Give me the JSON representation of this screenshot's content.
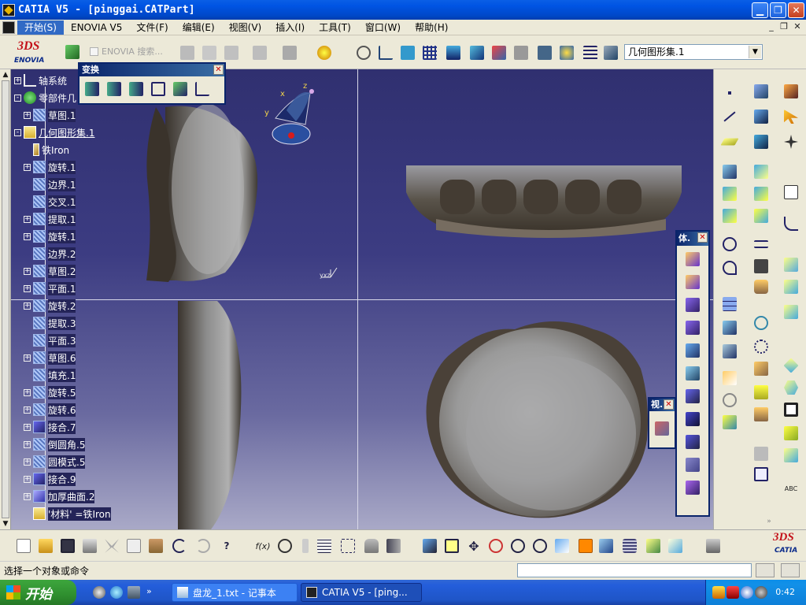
{
  "window": {
    "title": "CATIA V5 - [pinggai.CATPart]"
  },
  "menu": {
    "items": [
      "开始(S)",
      "ENOVIA V5",
      "文件(F)",
      "编辑(E)",
      "视图(V)",
      "插入(I)",
      "工具(T)",
      "窗口(W)",
      "帮助(H)"
    ]
  },
  "toolbar": {
    "search_label": "ENOVIA 搜索...",
    "geometrical_set": "几何图形集.1"
  },
  "logos": {
    "enovia": "ENOVIA",
    "catia": "CATIA",
    "ds": "3DS"
  },
  "compass_axes": {
    "x": "x",
    "y": "y",
    "z": "z"
  },
  "mini_axes": {
    "label": "yxz"
  },
  "tree": {
    "nodes": [
      {
        "label": "轴系统",
        "icon": "axis-icon"
      },
      {
        "label": "零部件几",
        "icon": "gear-icon"
      },
      {
        "label": "草图.1",
        "icon": "sketch-icon"
      },
      {
        "label": "几何图形集.1",
        "icon": "geometrical-set-icon"
      },
      {
        "label": "铁Iron",
        "icon": "material-icon"
      },
      {
        "label": "旋转.1",
        "icon": "revolve-icon"
      },
      {
        "label": "边界.1",
        "icon": "boundary-icon"
      },
      {
        "label": "交叉.1",
        "icon": "intersect-icon"
      },
      {
        "label": "提取.1",
        "icon": "extract-icon"
      },
      {
        "label": "旋转.1",
        "icon": "revolve-icon"
      },
      {
        "label": "边界.2",
        "icon": "boundary-icon"
      },
      {
        "label": "草图.2",
        "icon": "sketch-icon"
      },
      {
        "label": "平面.1",
        "icon": "plane-icon"
      },
      {
        "label": "旋转.2",
        "icon": "revolve-icon"
      },
      {
        "label": "提取.3",
        "icon": "extract-icon"
      },
      {
        "label": "平面.3",
        "icon": "plane-icon"
      },
      {
        "label": "草图.6",
        "icon": "sketch-icon"
      },
      {
        "label": "填充.1",
        "icon": "fill-icon"
      },
      {
        "label": "旋转.5",
        "icon": "revolve-icon"
      },
      {
        "label": "旋转.6",
        "icon": "revolve-icon"
      },
      {
        "label": "接合.7",
        "icon": "join-icon"
      },
      {
        "label": "倒圆角.5",
        "icon": "fillet-icon"
      },
      {
        "label": "圆模式.5",
        "icon": "circular-pattern-icon"
      },
      {
        "label": "接合.9",
        "icon": "join-icon"
      },
      {
        "label": "加厚曲面.2",
        "icon": "thick-surface-icon"
      },
      {
        "label": "'材料' =铁Iron",
        "icon": "material-param-icon"
      }
    ]
  },
  "panels": {
    "transform": {
      "title": "变换"
    },
    "body": {
      "title": "体."
    },
    "view": {
      "title": "视."
    }
  },
  "status": {
    "message": "选择一个对象或命令"
  },
  "taskbar": {
    "start_label": "开始",
    "tasks": [
      {
        "label": "盘龙_1.txt - 记事本"
      },
      {
        "label": "CATIA V5 - [ping..."
      }
    ],
    "clock": "0:42"
  },
  "colors": {
    "titlebar": "#0054e3",
    "viewport_top": "#303070",
    "viewport_bottom": "#a9a9c7",
    "accent": "#316ac5"
  }
}
